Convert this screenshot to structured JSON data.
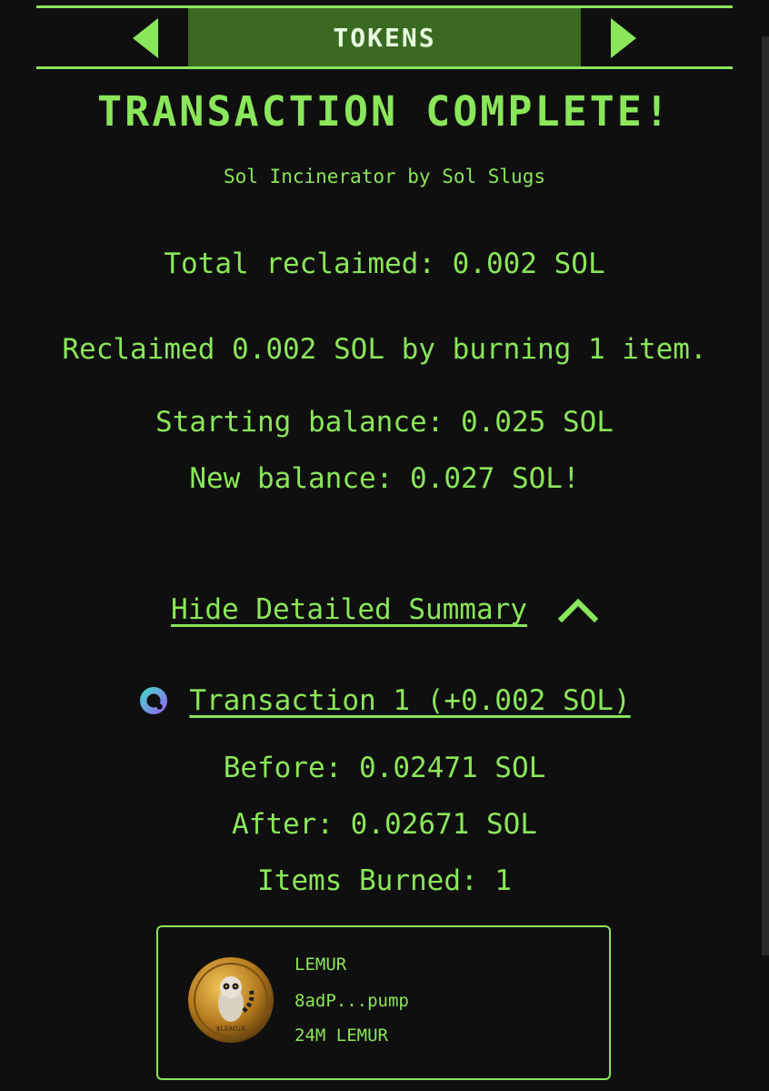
{
  "nav": {
    "title": "TOKENS",
    "prev_icon": "arrow-left-icon",
    "next_icon": "arrow-right-icon"
  },
  "headline": "TRANSACTION COMPLETE!",
  "subtitle": "Sol Incinerator by Sol Slugs",
  "summary": {
    "total_reclaimed": "Total reclaimed: 0.002 SOL",
    "reclaimed_detail": "Reclaimed 0.002 SOL by burning 1 item.",
    "starting_balance": "Starting balance: 0.025 SOL",
    "new_balance": "New balance: 0.027 SOL!"
  },
  "detail_toggle": {
    "label": "Hide Detailed Summary",
    "icon": "chevron-up-icon"
  },
  "transaction": {
    "icon": "explorer-icon",
    "link_label": "Transaction 1 (+0.002 SOL)",
    "before": "Before: 0.02471 SOL",
    "after": "After: 0.02671 SOL",
    "items_burned": "Items Burned: 1"
  },
  "token": {
    "name": "LEMUR",
    "address": "8adP...pump",
    "amount": "24M LEMUR",
    "coin_label": "$LEMUR"
  },
  "colors": {
    "background": "#0f0f0f",
    "accent": "#8ae65a",
    "nav_fill": "#3a6a22",
    "nav_text": "#e8ffe0"
  }
}
